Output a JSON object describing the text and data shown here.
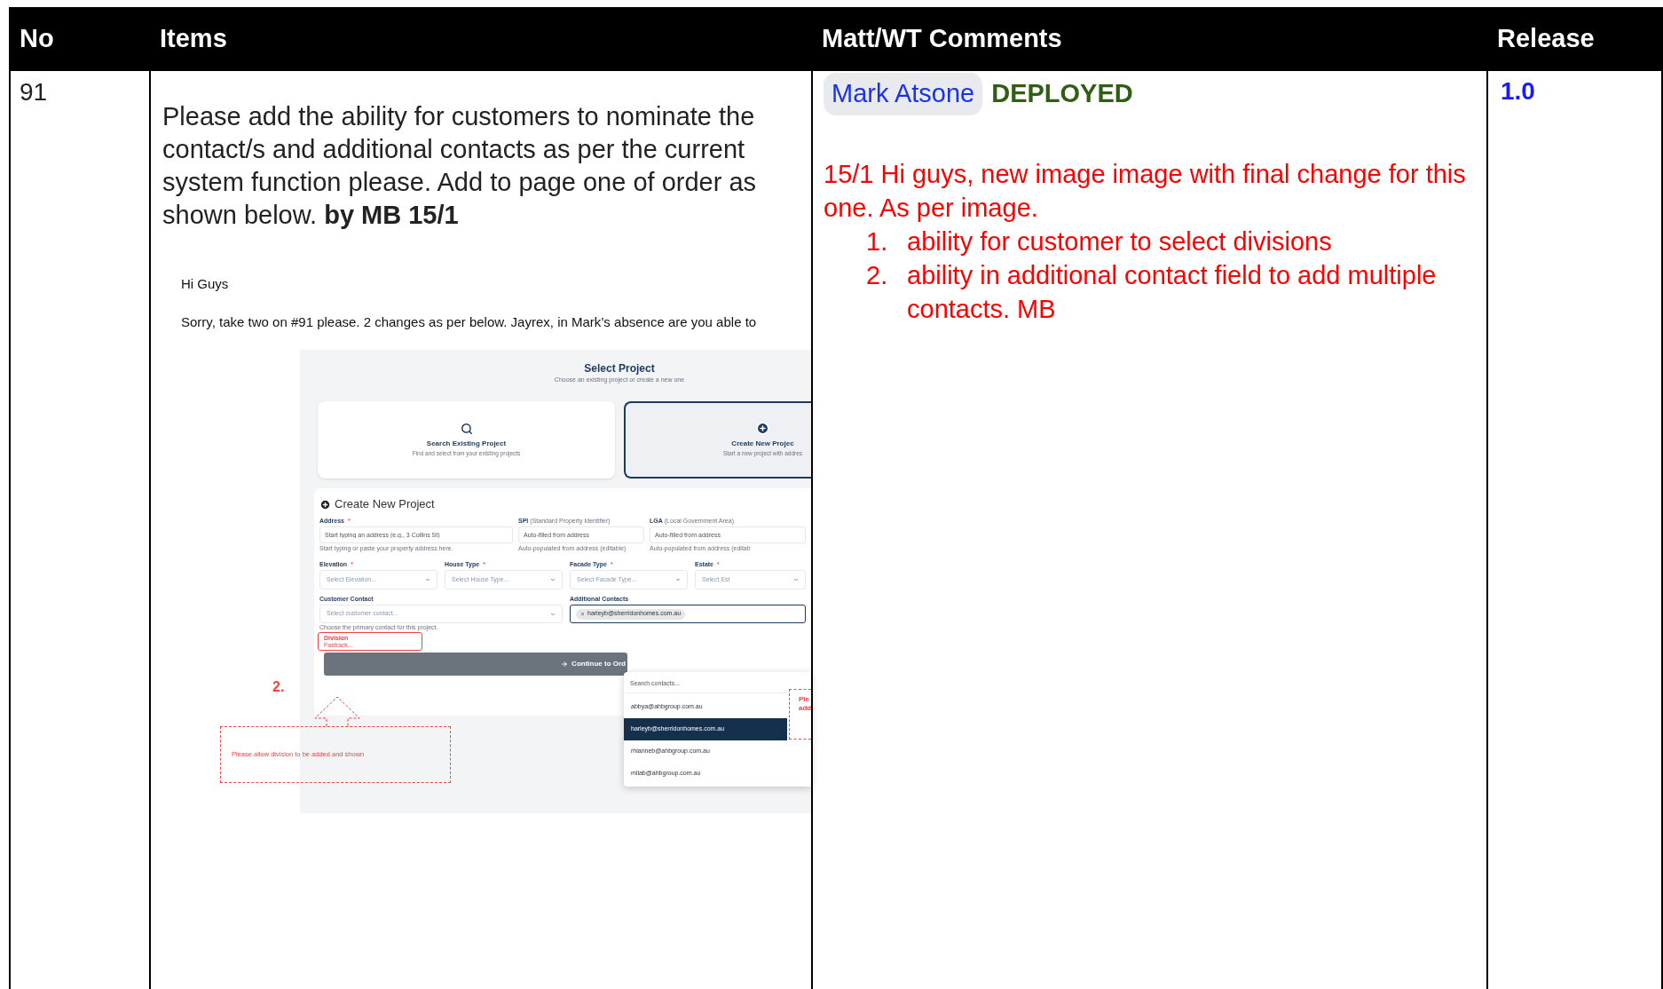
{
  "table": {
    "columns": [
      "No",
      "Items",
      "Matt/WT Comments",
      "Release"
    ],
    "rows": [
      {
        "no": "91",
        "item": {
          "text": "Please add the ability for customers to nominate the contact/s and additional contacts as per the current system function please. Add to page one of order as shown below. **by MB 15/1**",
          "attachment": {
            "greeting": "Hi Guys",
            "message": "Sorry, take two on #91 please. 2 changes as per below. Jayrex, in Mark’s absence are you able to",
            "screenshot": {
              "title": "Select Project",
              "subtitle": "Choose an existing project or create a new one",
              "options": [
                {
                  "kind": "search",
                  "title": "Search Existing Project",
                  "description": "Find and select from your existing projects",
                  "selected": false
                },
                {
                  "kind": "create",
                  "title": "Create New Projec",
                  "description": "Start a new project with addres",
                  "selected": true
                }
              ],
              "form_title": "Create New Project",
              "address_row": [
                {
                  "label": "Address",
                  "required_mark": "*",
                  "placeholder": "Start typing an address (e.g., 3 Collins St)",
                  "hint": "Start typing or paste your property address here."
                },
                {
                  "label": "SPI",
                  "note": "(Standard Property Identifier)",
                  "placeholder": "Auto-filled from address",
                  "hint": "Auto-populated from address (editable)"
                },
                {
                  "label": "LGA",
                  "note": "(Local Government Area)",
                  "placeholder": "Auto-filled from address",
                  "hint": "Auto-populated from address (editab"
                }
              ],
              "select_row": [
                {
                  "label": "Elevation",
                  "required_mark": "*",
                  "placeholder": "Select Elevation..."
                },
                {
                  "label": "House Type",
                  "required_mark": "*",
                  "placeholder": "Select House Type..."
                },
                {
                  "label": "Facade Type",
                  "required_mark": "*",
                  "placeholder": "Select Facade Type..."
                },
                {
                  "label": "Estate",
                  "required_mark": "*",
                  "placeholder": "Select Est"
                }
              ],
              "customer_contact": {
                "label": "Customer Contact",
                "placeholder": "Select customer contact...",
                "hint": "Choose the primary contact for this project."
              },
              "additional_contacts": {
                "label": "Additional Contacts",
                "chips": [
                  "harleyb@sherridonhomes.com.au"
                ]
              },
              "division": {
                "label": "Division",
                "value": "Fastrack..."
              },
              "continue_button": "Continue to Ord",
              "dropdown": {
                "search_placeholder": "Search contacts...",
                "options": [
                  {
                    "text": "abbya@ahbgroup.com.au",
                    "selected": false
                  },
                  {
                    "text": "harleyb@sherridonhomes.com.au",
                    "selected": true
                  },
                  {
                    "text": "rhianneb@ahbgroup.com.au",
                    "selected": false
                  },
                  {
                    "text": "milab@ahbgroup.com.au",
                    "selected": false
                  }
                ]
              }
            },
            "annotations": {
              "number": "2.",
              "note": "Please allow division to be added and shown",
              "side_note": [
                "Ple",
                "add"
              ]
            }
          }
        },
        "comments": {
          "mention": "Mark Atsone",
          "status": "DEPLOYED",
          "note": "15/1 Hi guys, new image image with final change for this one. As per image.",
          "list": [
            {
              "marker": "1.",
              "text": "ability for customer to select divisions"
            },
            {
              "marker": "2.",
              "text": "ability in additional contact field to add multiple contacts. MB"
            }
          ]
        },
        "release": "1.0"
      }
    ]
  }
}
